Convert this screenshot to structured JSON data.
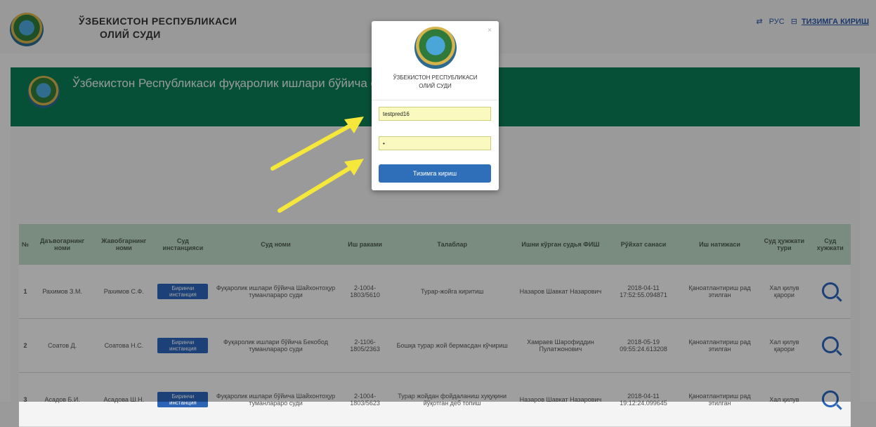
{
  "header": {
    "brand_line1": "ЎЗБЕКИСТОН РЕСПУБЛИКАСИ",
    "brand_line2": "ОЛИЙ СУДИ",
    "lang_label": "РУС",
    "login_label": "ТИЗИМГА КИРИШ"
  },
  "banner": {
    "text": "Ўзбекистон Республикаси фуқаролик ишлари бўйича суд қарор банки"
  },
  "table": {
    "headers": [
      "№",
      "Даъвогарнинг номи",
      "Жавобгарнинг номи",
      "Суд инстанцияси",
      "Суд номи",
      "Иш раками",
      "Талаблар",
      "Ишни кўрган судья ФИШ",
      "Рўйхат санаси",
      "Иш натижаси",
      "Суд ҳужжати тури",
      "Суд хужжати"
    ],
    "rows": [
      {
        "n": "1",
        "plaintiff": "Рахимов З.М.",
        "defendant": "Рахимов С.Ф.",
        "instance": "Биринчи инстанция",
        "court": "Фуқаролик ишлари бўйича Шайхонтоҳур туманлараро суди",
        "case": "2-1004-1803/5610",
        "claim": "Турар-жойга киритиш",
        "judge": "Назаров Шавкат Назарович",
        "date": "2018-04-11 17:52:55.094871",
        "result": "Қаноатлантириш рад этилган",
        "doc_type": "Хал қилув қарори"
      },
      {
        "n": "2",
        "plaintiff": "Соатов Д.",
        "defendant": "Соатова Н.С.",
        "instance": "Биринчи инстанция",
        "court": "Фуқаролик ишлари бўйича Бекобод туманлараро суди",
        "case": "2-1106-1805/2363",
        "claim": "Бошқа турар жой бермасдан кўчириш",
        "judge": "Хамраев Шарофиддин Пулатжонович",
        "date": "2018-05-19 09:55:24.613208",
        "result": "Қаноатлантириш рад этилган",
        "doc_type": "Хал қилув қарори"
      },
      {
        "n": "3",
        "plaintiff": "Асадов Б.И.",
        "defendant": "Асадова Ш.Н.",
        "instance": "Биринчи инстанция",
        "court": "Фуқаролик ишлари бўйича Шайхонтоҳур туманлараро суди",
        "case": "2-1004-1803/5623",
        "claim": "Турар жойдан фойдаланиш хуқуқини йўқотган деб топиш",
        "judge": "Назаров Шавкат Назарович",
        "date": "2018-04-11 19:12:24.099645",
        "result": "Қаноатлантириш рад этилган",
        "doc_type": "Хал қилув"
      }
    ]
  },
  "modal": {
    "title_line1": "ЎЗБЕКИСТОН РЕСПУБЛИКАСИ",
    "title_line2": "ОЛИЙ СУДИ",
    "close": "×",
    "username_value": "testpred16",
    "password_value": "•",
    "submit_label": "Тизимга кириш"
  },
  "colors": {
    "banner": "#0c7b56",
    "header_row": "#bcd8c4",
    "primary": "#2f6fba",
    "arrow": "#f5e83a"
  }
}
